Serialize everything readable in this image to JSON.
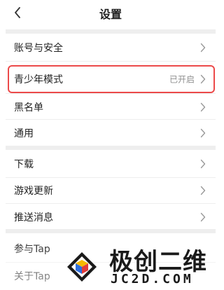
{
  "header": {
    "title": "设置",
    "back_icon": "chevron-left-icon"
  },
  "rows": [
    {
      "label": "账号与安全",
      "value": ""
    },
    {
      "label": "青少年模式",
      "value": "已开启",
      "highlighted": true
    },
    {
      "label": "黑名单",
      "value": ""
    },
    {
      "label": "通用",
      "value": ""
    },
    {
      "label": "下载",
      "value": ""
    },
    {
      "label": "游戏更新",
      "value": ""
    },
    {
      "label": "推送消息",
      "value": ""
    },
    {
      "label": "参与Tap",
      "value": ""
    },
    {
      "label": "关于Tap",
      "value": ""
    }
  ],
  "watermark": {
    "brand_cn": "极创二维",
    "brand_en": "JC2D.COM"
  },
  "colors": {
    "highlight_border": "#ec4a4a",
    "chevron": "#9a9a9a",
    "divider": "#eeeeee"
  }
}
